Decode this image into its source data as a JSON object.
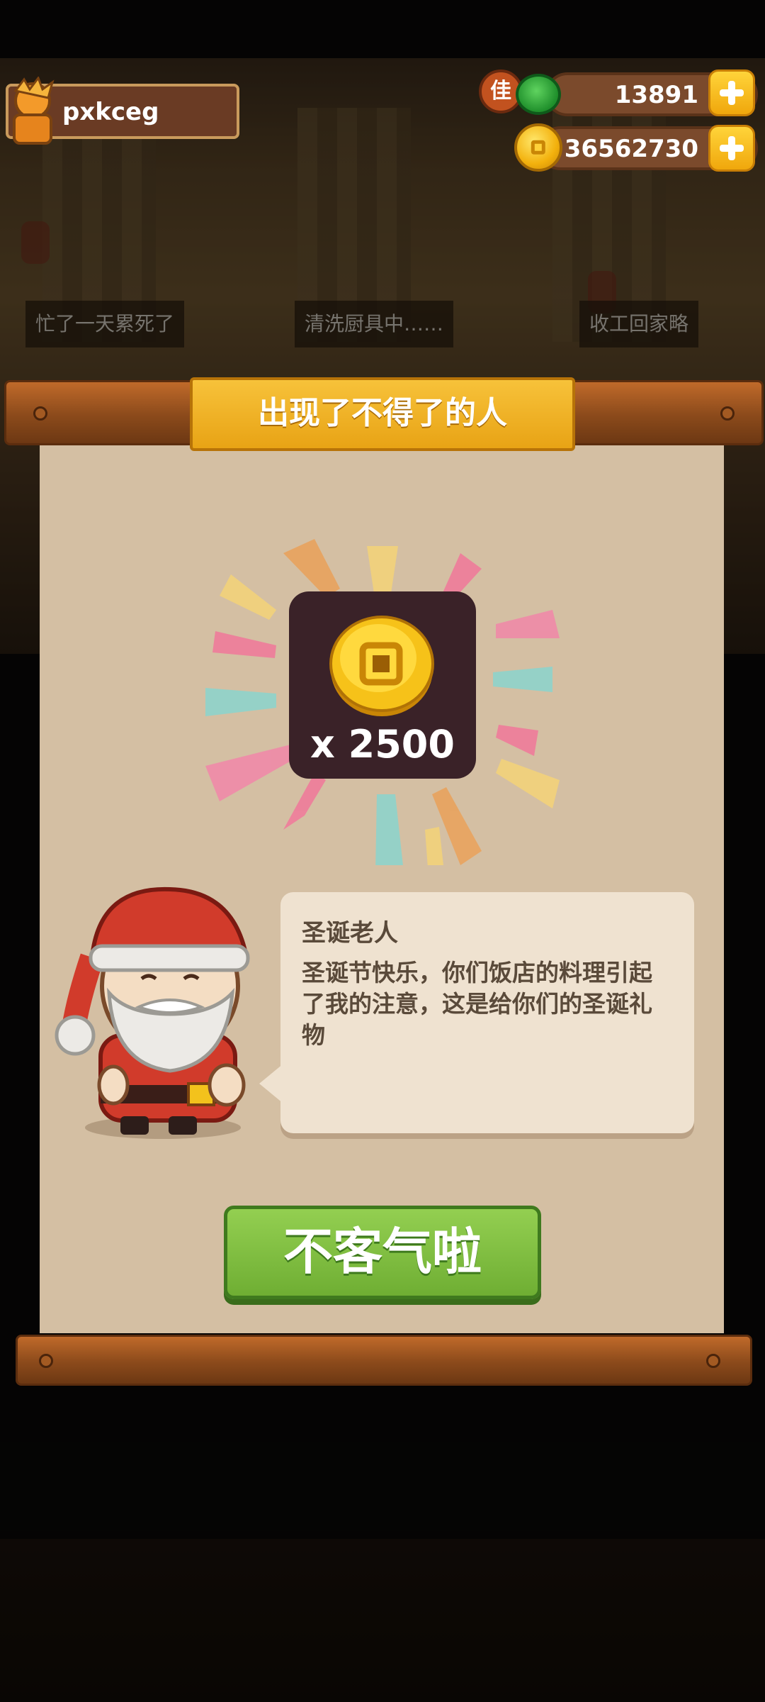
{
  "player": {
    "name": "pxkceg",
    "avatar_icon": "orange-character-avatar-icon"
  },
  "currencies": {
    "jade": {
      "badge": "佳",
      "value": "13891",
      "icon": "green-jade-icon"
    },
    "coins": {
      "value": "36562730",
      "icon": "gold-coin-icon"
    }
  },
  "background": {
    "labels": [
      "忙了一天累死了",
      "清洗厨具中……",
      "收工回家略"
    ]
  },
  "dialog": {
    "title": "出现了不得了的人",
    "reward": {
      "icon": "gold-coin-icon",
      "quantity": "x 2500"
    },
    "speaker": "圣诞老人",
    "message": "圣诞节快乐，你们饭店的料理引起了我的注意，这是给你们的圣诞礼物",
    "confirm_label": "不客气啦",
    "character_icon": "santa-claus-icon"
  },
  "colors": {
    "confirm_green": "#7fbe41",
    "title_gold": "#f0b426",
    "paper": "#d4bfa3"
  }
}
